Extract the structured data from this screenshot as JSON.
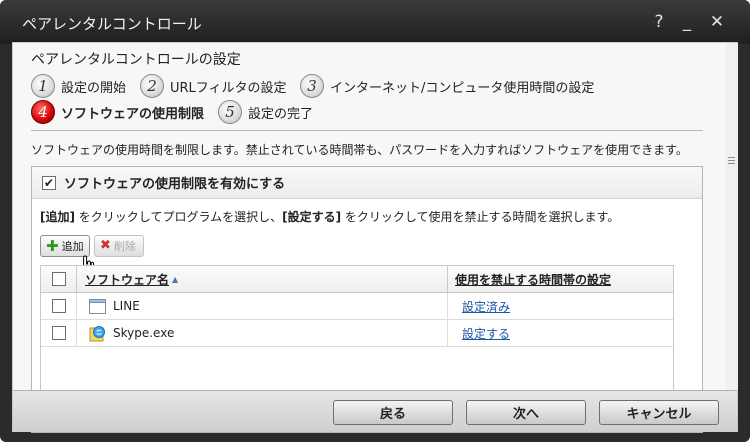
{
  "window": {
    "title": "ペアレンタルコントロール",
    "help": "?",
    "minimize": "_",
    "close": "✕"
  },
  "heading": "ペアレンタルコントロールの設定",
  "steps": [
    {
      "num": "1",
      "label": "設定の開始"
    },
    {
      "num": "2",
      "label": "URLフィルタの設定"
    },
    {
      "num": "3",
      "label": "インターネット/コンピュータ使用時間の設定"
    },
    {
      "num": "4",
      "label": "ソフトウェアの使用制限",
      "active": true
    },
    {
      "num": "5",
      "label": "設定の完了"
    }
  ],
  "description": "ソフトウェアの使用時間を制限します。禁止されている時間帯も、パスワードを入力すればソフトウェアを使用できます。",
  "enable": {
    "label": "ソフトウェアの使用制限を有効にする",
    "checked": true
  },
  "instruction": {
    "add_tag": "[追加]",
    "part1": " をクリックしてプログラムを選択し、",
    "set_tag": "[設定する]",
    "part2": " をクリックして使用を禁止する時間を選択します。"
  },
  "toolbar": {
    "add_label": "追加",
    "delete_label": "削除"
  },
  "table": {
    "headers": {
      "name": "ソフトウェア名",
      "time": "使用を禁止する時間帯の設定"
    },
    "rows": [
      {
        "name": "LINE",
        "time_link": "設定済み"
      },
      {
        "name": "Skype.exe",
        "time_link": "設定する"
      }
    ]
  },
  "footer": {
    "back": "戻る",
    "next": "次へ",
    "cancel": "キャンセル"
  }
}
